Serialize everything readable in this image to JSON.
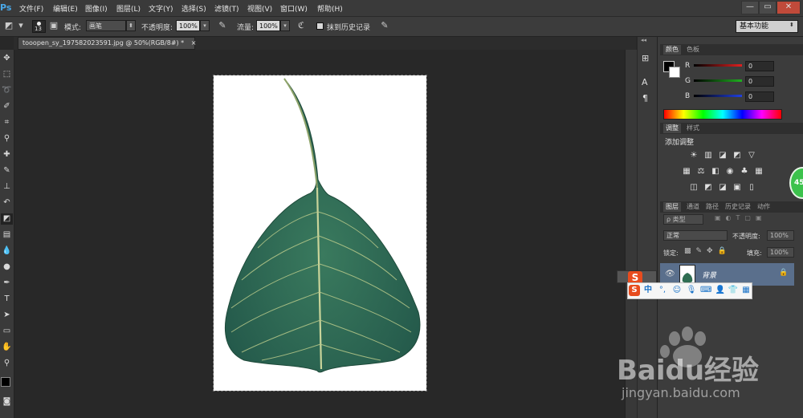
{
  "app": {
    "logo": "Ps"
  },
  "menu": [
    "文件(F)",
    "编辑(E)",
    "图像(I)",
    "图层(L)",
    "文字(Y)",
    "选择(S)",
    "滤镜(T)",
    "视图(V)",
    "窗口(W)",
    "帮助(H)"
  ],
  "window_controls": [
    "—",
    "▭",
    "✕"
  ],
  "options": {
    "brush_size": "13",
    "mode_label": "模式:",
    "mode_value": "画笔",
    "opacity_label": "不透明度:",
    "opacity_value": "100%",
    "flow_label": "流量:",
    "flow_value": "100%",
    "erase_history_label": "抹到历史记录",
    "workspace": "基本功能"
  },
  "document": {
    "tab_title": "tooopen_sy_197582023591.jpg @ 50%(RGB/8#) *",
    "close": "×"
  },
  "color_panel": {
    "tabs": [
      "颜色",
      "色板"
    ],
    "channels": [
      {
        "label": "R",
        "value": "0",
        "color": "#e02020"
      },
      {
        "label": "G",
        "value": "0",
        "color": "#20b020"
      },
      {
        "label": "B",
        "value": "0",
        "color": "#2040e0"
      }
    ]
  },
  "adjust_panel": {
    "tabs": [
      "调整",
      "样式"
    ],
    "title": "添加调整"
  },
  "layers_panel": {
    "tabs": [
      "图层",
      "通道",
      "路径",
      "历史记录",
      "动作"
    ],
    "filter_kind": "ρ 类型",
    "blend_mode": "正常",
    "opacity_label": "不透明度:",
    "opacity_value": "100%",
    "lock_label": "锁定:",
    "fill_label": "填充:",
    "fill_value": "100%",
    "layer_name": "背景"
  },
  "ime": {
    "logo": "S",
    "mode": "中"
  },
  "overlay": {
    "badge": "45",
    "watermark_brand": "Baidu经验",
    "watermark_url": "jingyan.baidu.com"
  },
  "colors": {
    "accent": "#4aa8e8",
    "leaf": "#2f6d52",
    "selected_layer": "#5a6f8c"
  }
}
